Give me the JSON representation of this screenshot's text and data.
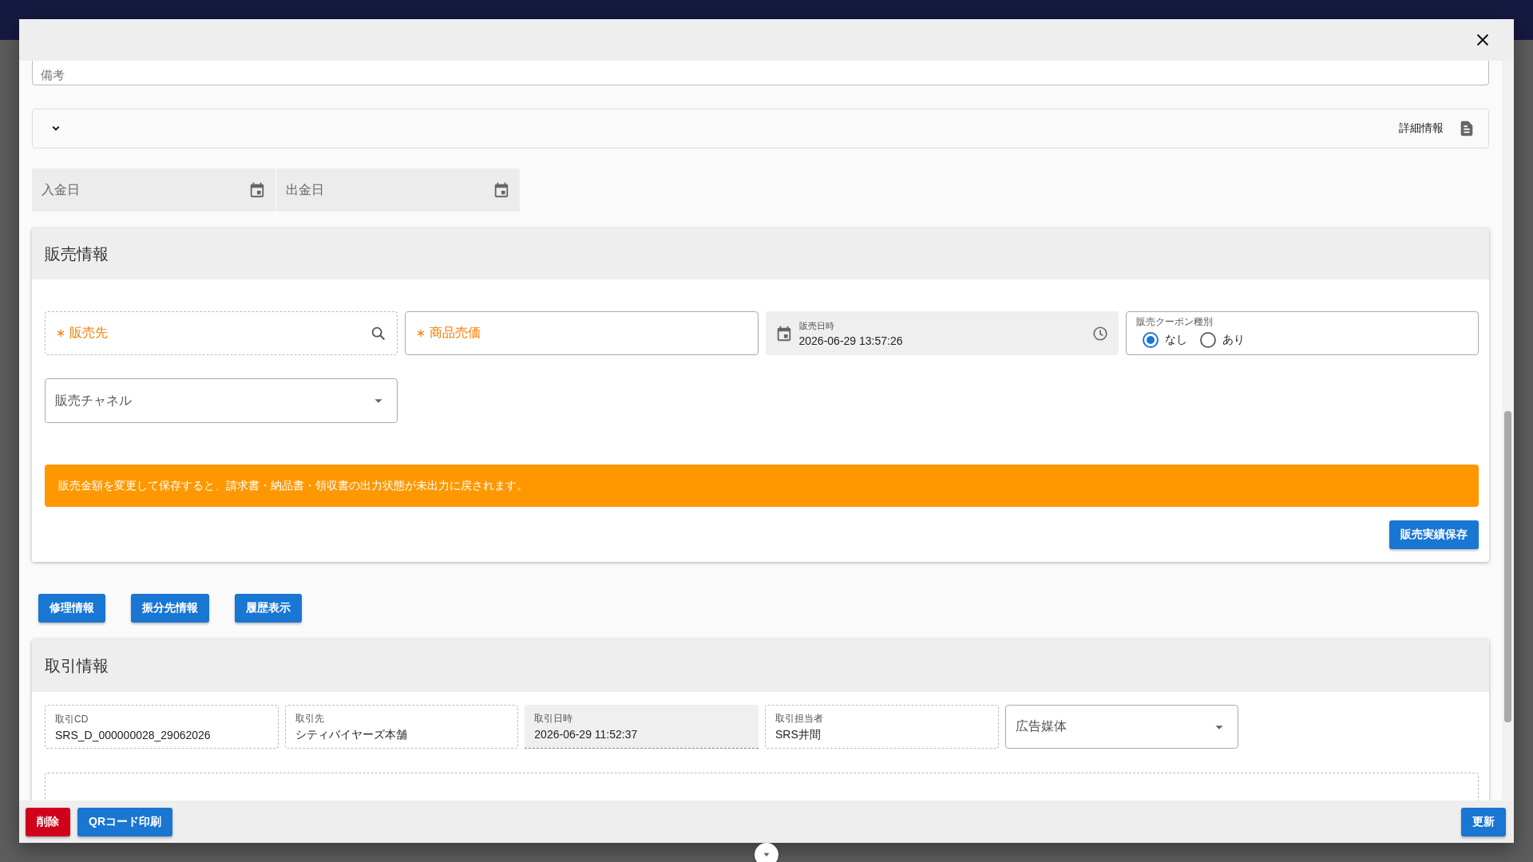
{
  "remarks_field": {
    "placeholder": "備考"
  },
  "details_panel": {
    "label": "詳細情報",
    "expanded": false
  },
  "date_fields": [
    {
      "placeholder": "入金日"
    },
    {
      "placeholder": "出金日"
    }
  ],
  "sales_card": {
    "title": "販売情報",
    "fields": [
      {
        "kind": "search",
        "label": "販売先",
        "required": true
      },
      {
        "kind": "text",
        "label": "商品売価",
        "required": true
      },
      {
        "kind": "datetime",
        "label": "販売日時",
        "value": "2026-06-29 13:57:26"
      },
      {
        "kind": "radio",
        "label": "販売クーポン種別",
        "options": [
          {
            "label": "なし",
            "selected": true
          },
          {
            "label": "あり",
            "selected": false
          }
        ]
      },
      {
        "kind": "select",
        "label": "販売チャネル"
      }
    ],
    "alert": "販売金額を変更して保存すると、請求書・納品書・領収書の出力状態が未出力に戻されます。",
    "save_button": "販売実績保存"
  },
  "action_buttons": [
    "修理情報",
    "振分先情報",
    "履歴表示"
  ],
  "trade_card": {
    "title": "取引情報",
    "fields": [
      {
        "kind": "readonly",
        "label": "取引CD",
        "value": "SRS_D_000000028_29062026"
      },
      {
        "kind": "readonly",
        "label": "取引先",
        "value": "シティバイヤーズ本舗"
      },
      {
        "kind": "filled",
        "label": "取引日時",
        "value": "2026-06-29 11:52:37"
      },
      {
        "kind": "readonly",
        "label": "取引担当者",
        "value": "SRS井間"
      },
      {
        "kind": "select",
        "label": "広告媒体"
      }
    ]
  },
  "footer_buttons": [
    {
      "label": "削除",
      "kind": "danger"
    },
    {
      "label": "QRコード印刷",
      "kind": "primary"
    },
    {
      "label": "更新",
      "kind": "primary"
    }
  ]
}
